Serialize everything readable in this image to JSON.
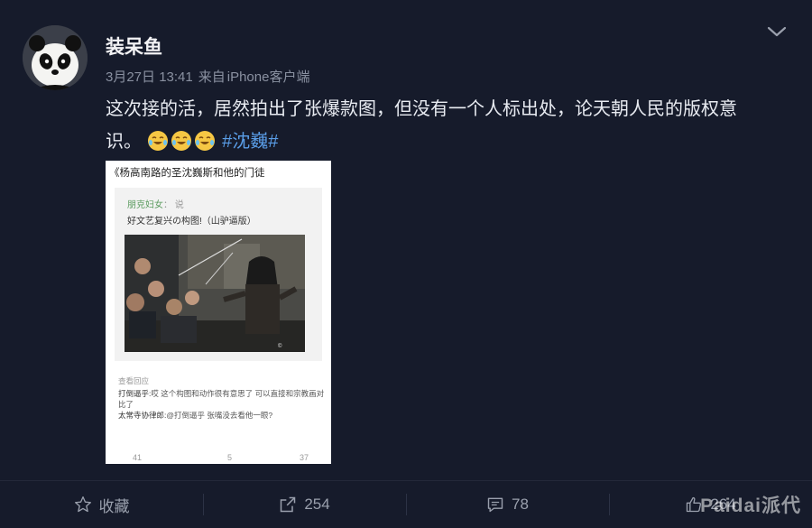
{
  "post": {
    "username": "装呆鱼",
    "date": "3月27日 13:41",
    "source_prefix": "来自",
    "source": "iPhone客户端",
    "text_line1": "这次接的活，居然拍出了张爆款图，但没有一个人标出处，论天朝人民的版权意",
    "text_line2": "识。",
    "topic": "#沈巍#",
    "emoji_icon": "laughing-tears-icon"
  },
  "card": {
    "title": "《杨高南路的圣沈巍斯和他的门徒",
    "inner_user": "朋克妇女",
    "inner_said": "说",
    "inner_text": "好文艺复兴の构图!（山驴逼版）",
    "comments_header": "查看回应",
    "comment1_name": "打倒逼乎:",
    "comment1_text": "哎 这个构图和动作很有意思了 可以直接和宗教画对比了",
    "comment2_name": "太常寺协律郎:",
    "comment2_text": "@打倒逼乎 张嘴没去看他一眼?",
    "foot_like": "41",
    "foot_comment": "5",
    "foot_repost": "37"
  },
  "actions": {
    "favorite_label": "收藏",
    "repost_count": "254",
    "comment_count": "78",
    "like_count": "264"
  },
  "watermark": "Paidai派代",
  "colors": {
    "background": "#161b2b",
    "topic": "#5a9ee8",
    "meta": "#8a91a1"
  }
}
